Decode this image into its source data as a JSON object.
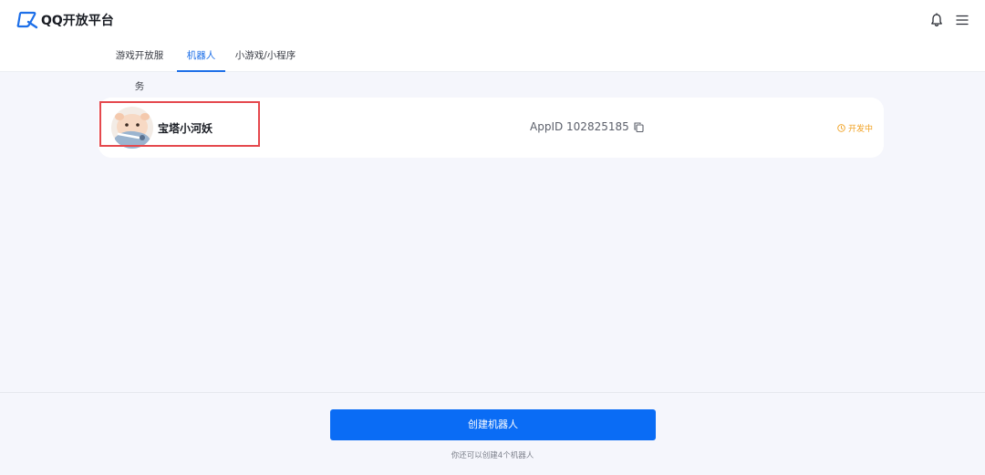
{
  "header": {
    "logo_text": "QQ开放平台",
    "brand_color": "#1d6fe8",
    "icons": [
      "bell-icon",
      "menu-icon"
    ]
  },
  "tabs": [
    {
      "label": "游戏开放服务",
      "active": false
    },
    {
      "label": "机器人",
      "active": true
    },
    {
      "label": "小游戏/小程序",
      "active": false
    }
  ],
  "bot": {
    "name": "宝塔小河妖",
    "appid_label": "AppID 102825185",
    "status": "开发中",
    "status_color": "#f0a020",
    "highlight_color": "#e5484d"
  },
  "footer": {
    "create_button": "创建机器人",
    "hint": "你还可以创建4个机器人",
    "button_color": "#0a6cf5"
  }
}
